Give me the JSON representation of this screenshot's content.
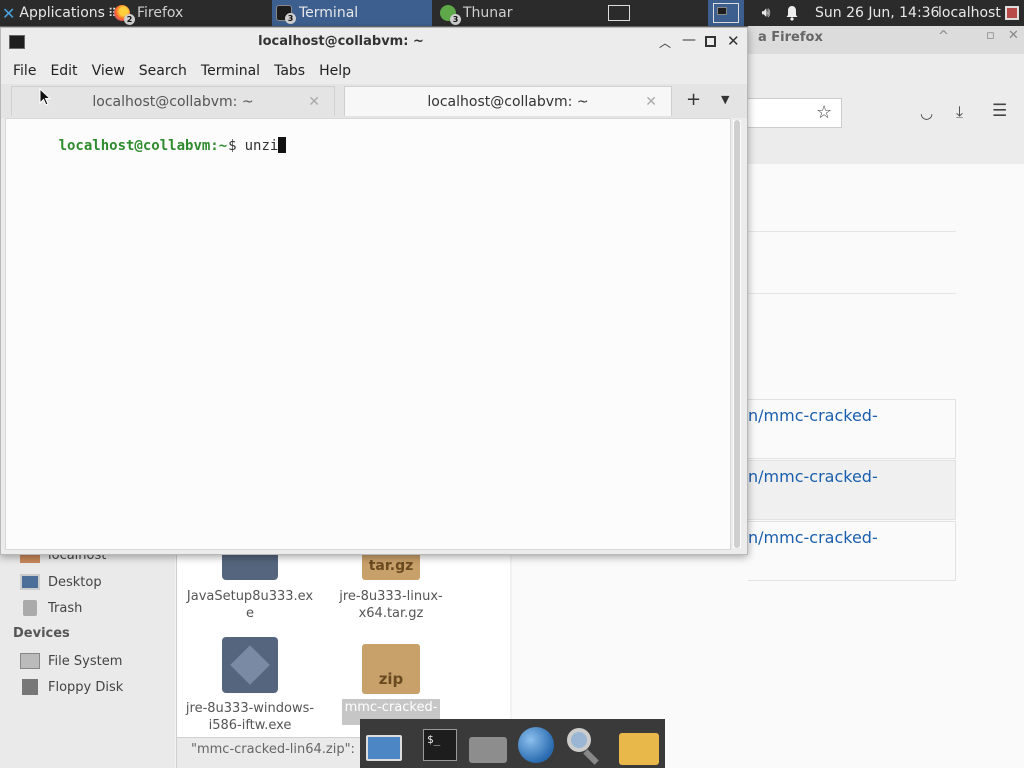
{
  "panel": {
    "applications_label": "Applications",
    "applications_suffix": "⠿",
    "tasks": [
      {
        "label": "Firefox",
        "badge": "2"
      },
      {
        "label": "Terminal",
        "badge": "3"
      },
      {
        "label": "Thunar",
        "badge": "3"
      }
    ],
    "datetime": "Sun 26 Jun, 14:36",
    "username": "localhost"
  },
  "firefox": {
    "title_fragment": "a Firefox",
    "links": [
      "n/mmc-cracked-",
      "n/mmc-cracked-",
      "n/mmc-cracked-"
    ]
  },
  "terminal": {
    "title": "localhost@collabvm: ~",
    "menu": [
      "File",
      "Edit",
      "View",
      "Search",
      "Terminal",
      "Tabs",
      "Help"
    ],
    "tabs": [
      {
        "label": "localhost@collabvm: ~",
        "active": false
      },
      {
        "label": "localhost@collabvm: ~",
        "active": true
      }
    ],
    "prompt_user": "localhost@collabvm",
    "prompt_path": ":~",
    "prompt_symbol": "$",
    "command": "unzi"
  },
  "thunar": {
    "sidebar": {
      "partial_item": "localhost",
      "places": [
        {
          "label": "Desktop",
          "icon": "desktop-icon"
        },
        {
          "label": "Trash",
          "icon": "trash-icon"
        }
      ],
      "devices_heading": "Devices",
      "devices": [
        {
          "label": "File System",
          "icon": "drive-icon"
        },
        {
          "label": "Floppy Disk",
          "icon": "floppy-icon"
        }
      ]
    },
    "files": [
      {
        "name": "JavaSetup8u333.exe",
        "line1": "JavaSetup8u333.ex",
        "line2": "e",
        "icon": "exe-icon"
      },
      {
        "name": "jre-8u333-linux-x64.tar.gz",
        "line1": "jre-8u333-linux-",
        "line2": "x64.tar.gz",
        "icon": "archive-icon",
        "icon_label": "tar.gz"
      },
      {
        "name": "jre-8u333-windows-i586-iftw.exe",
        "line1": "jre-8u333-windows-",
        "line2": "i586-iftw.exe",
        "icon": "exe-icon"
      },
      {
        "name": "mmc-cracked-lin64.zip",
        "line1": "mmc-cracked-",
        "line2": "",
        "icon": "zip-icon",
        "icon_label": "zip",
        "selected": true
      }
    ],
    "statusbar": "\"mmc-cracked-lin64.zip\":"
  },
  "colors": {
    "prompt_green": "#2e8b2e",
    "panel_bg": "#2b2b2b",
    "active_task": "#3c5f8f",
    "link_blue": "#1a5fae"
  }
}
